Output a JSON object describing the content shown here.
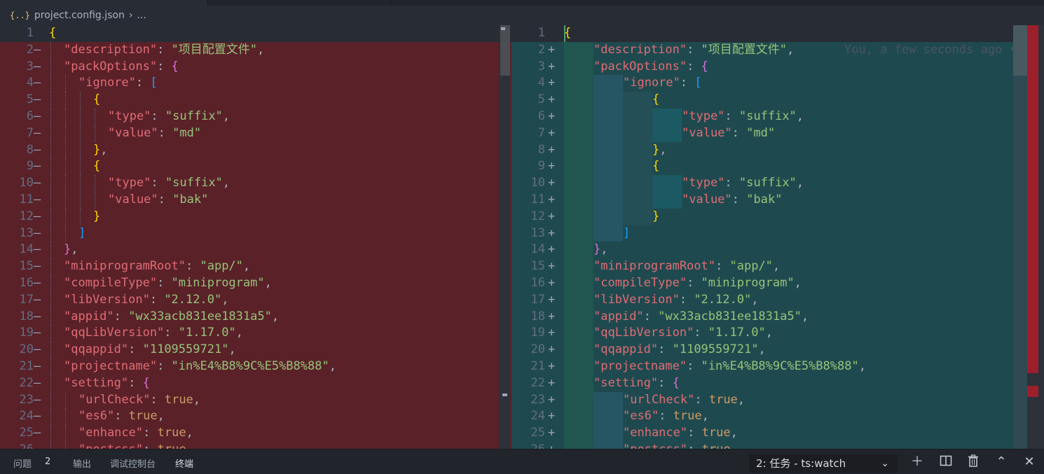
{
  "breadcrumb": {
    "icon": "{..}",
    "file": "project.config.json",
    "more": "..."
  },
  "blame": "You, a few seconds ago •",
  "markers": {
    "removed": "—",
    "added": "+"
  },
  "lines": [
    {
      "num": "1",
      "level": 0
    },
    {
      "num": "2",
      "level": 1
    },
    {
      "num": "3",
      "level": 1
    },
    {
      "num": "4",
      "level": 2
    },
    {
      "num": "5",
      "level": 3
    },
    {
      "num": "6",
      "level": 4
    },
    {
      "num": "7",
      "level": 4
    },
    {
      "num": "8",
      "level": 3
    },
    {
      "num": "9",
      "level": 3
    },
    {
      "num": "10",
      "level": 4
    },
    {
      "num": "11",
      "level": 4
    },
    {
      "num": "12",
      "level": 3
    },
    {
      "num": "13",
      "level": 2
    },
    {
      "num": "14",
      "level": 1
    },
    {
      "num": "15",
      "level": 1
    },
    {
      "num": "16",
      "level": 1
    },
    {
      "num": "17",
      "level": 1
    },
    {
      "num": "18",
      "level": 1
    },
    {
      "num": "19",
      "level": 1
    },
    {
      "num": "20",
      "level": 1
    },
    {
      "num": "21",
      "level": 1
    },
    {
      "num": "22",
      "level": 1
    },
    {
      "num": "23",
      "level": 2
    },
    {
      "num": "24",
      "level": 2
    },
    {
      "num": "25",
      "level": 2
    },
    {
      "num": "26",
      "level": 2
    }
  ],
  "code": {
    "l1": "{",
    "description_key": "\"description\"",
    "description_val": "\"项目配置文件\"",
    "packOptions_key": "\"packOptions\"",
    "ignore_key": "\"ignore\"",
    "type_key": "\"type\"",
    "suffix_val": "\"suffix\"",
    "value_key": "\"value\"",
    "md_val": "\"md\"",
    "bak_val": "\"bak\"",
    "miniprogramRoot_key": "\"miniprogramRoot\"",
    "miniprogramRoot_val": "\"app/\"",
    "compileType_key": "\"compileType\"",
    "compileType_val": "\"miniprogram\"",
    "libVersion_key": "\"libVersion\"",
    "libVersion_val": "\"2.12.0\"",
    "appid_key": "\"appid\"",
    "appid_val": "\"wx33acb831ee1831a5\"",
    "qqLibVersion_key": "\"qqLibVersion\"",
    "qqLibVersion_val": "\"1.17.0\"",
    "qqappid_key": "\"qqappid\"",
    "qqappid_val": "\"1109559721\"",
    "projectname_key": "\"projectname\"",
    "projectname_val": "\"in%E4%B8%9C%E5%B8%88\"",
    "setting_key": "\"setting\"",
    "urlCheck_key": "\"urlCheck\"",
    "es6_key": "\"es6\"",
    "enhance_key": "\"enhance\"",
    "postcss_key": "\"postcss\"",
    "true_val": "true"
  },
  "panel": {
    "tabs": [
      "问题",
      "输出",
      "调试控制台",
      "终端"
    ],
    "problems_count": "2",
    "terminal_select": "2: 任务 - ts:watch"
  },
  "colors": {
    "removed_bg": "#5a2129",
    "added_bg": "#1e4a4f",
    "key": "#e06c75",
    "string": "#98c379",
    "number": "#d19a66"
  }
}
